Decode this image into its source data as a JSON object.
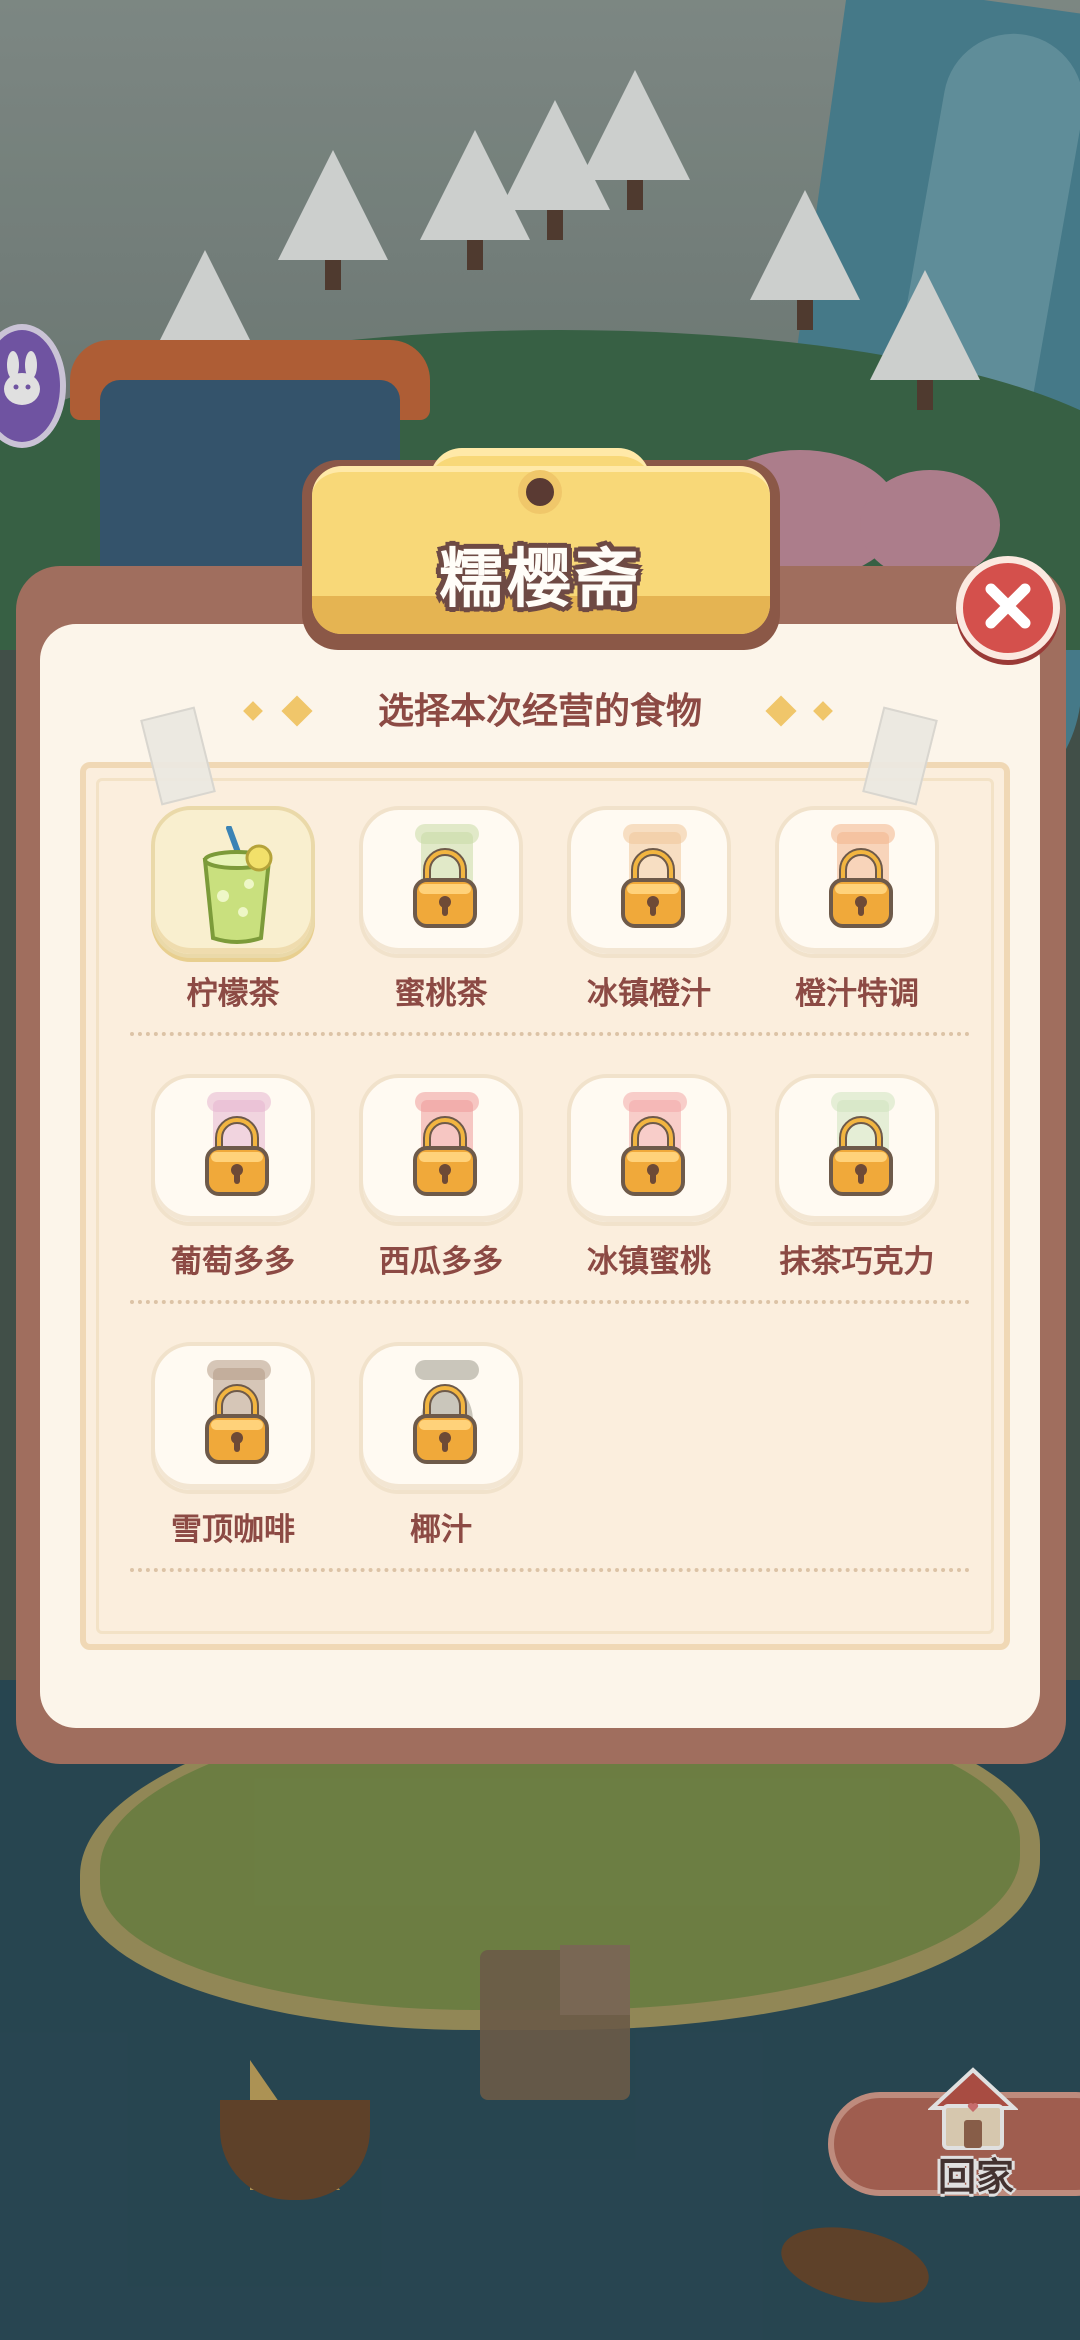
{
  "modal": {
    "title": "糯樱斋",
    "subtitle": "选择本次经营的食物",
    "close_icon": "close-icon"
  },
  "items": [
    {
      "name": "柠檬茶",
      "locked": false,
      "selected": true,
      "color": "#b9d86a"
    },
    {
      "name": "蜜桃茶",
      "locked": true,
      "selected": false,
      "color": "#c9dba5"
    },
    {
      "name": "冰镇橙汁",
      "locked": true,
      "selected": false,
      "color": "#f0c79a"
    },
    {
      "name": "橙汁特调",
      "locked": true,
      "selected": false,
      "color": "#f2b48d"
    },
    {
      "name": "葡萄多多",
      "locked": true,
      "selected": false,
      "color": "#e6b5cf"
    },
    {
      "name": "西瓜多多",
      "locked": true,
      "selected": false,
      "color": "#ef9a9a"
    },
    {
      "name": "冰镇蜜桃",
      "locked": true,
      "selected": false,
      "color": "#f2a7a7"
    },
    {
      "name": "抹茶巧克力",
      "locked": true,
      "selected": false,
      "color": "#cfe3c0"
    },
    {
      "name": "雪顶咖啡",
      "locked": true,
      "selected": false,
      "color": "#b59a86"
    },
    {
      "name": "椰汁",
      "locked": true,
      "selected": false,
      "color": "#9e9a8e"
    }
  ],
  "home_button": {
    "label": "回家",
    "icon": "house-icon"
  },
  "side_button": {
    "icon": "rabbit-icon"
  },
  "colors": {
    "accent": "#8c4a44",
    "close": "#d4504c",
    "title_plate": "#f8d878"
  }
}
